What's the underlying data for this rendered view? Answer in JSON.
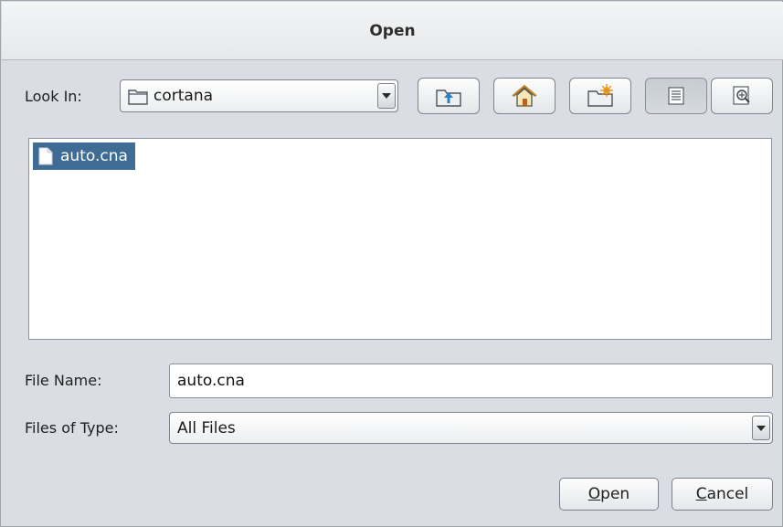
{
  "dialog": {
    "title": "Open"
  },
  "look_in": {
    "label": "Look In:",
    "value": "cortana",
    "icon": "folder-icon"
  },
  "toolbar": {
    "buttons": [
      {
        "name": "up-one-level",
        "icon": "folder-up-icon",
        "pressed": false
      },
      {
        "name": "home",
        "icon": "home-icon",
        "pressed": false
      },
      {
        "name": "new-folder",
        "icon": "new-folder-icon",
        "pressed": false
      },
      {
        "name": "list-view",
        "icon": "list-view-icon",
        "pressed": true
      },
      {
        "name": "details-view",
        "icon": "details-view-icon",
        "pressed": false
      }
    ]
  },
  "file_list": {
    "items": [
      {
        "name": "auto.cna",
        "icon": "file-icon",
        "selected": true
      }
    ]
  },
  "file_name": {
    "label": "File Name:",
    "value": "auto.cna"
  },
  "file_type": {
    "label": "Files of Type:",
    "value": "All Files"
  },
  "actions": {
    "open_mnemonic": "O",
    "open_rest": "pen",
    "cancel_mnemonic": "C",
    "cancel_rest": "ancel"
  },
  "colors": {
    "selection": "#3e6c95",
    "background": "#dadde3",
    "accent_folder": "#3b8fd0"
  }
}
